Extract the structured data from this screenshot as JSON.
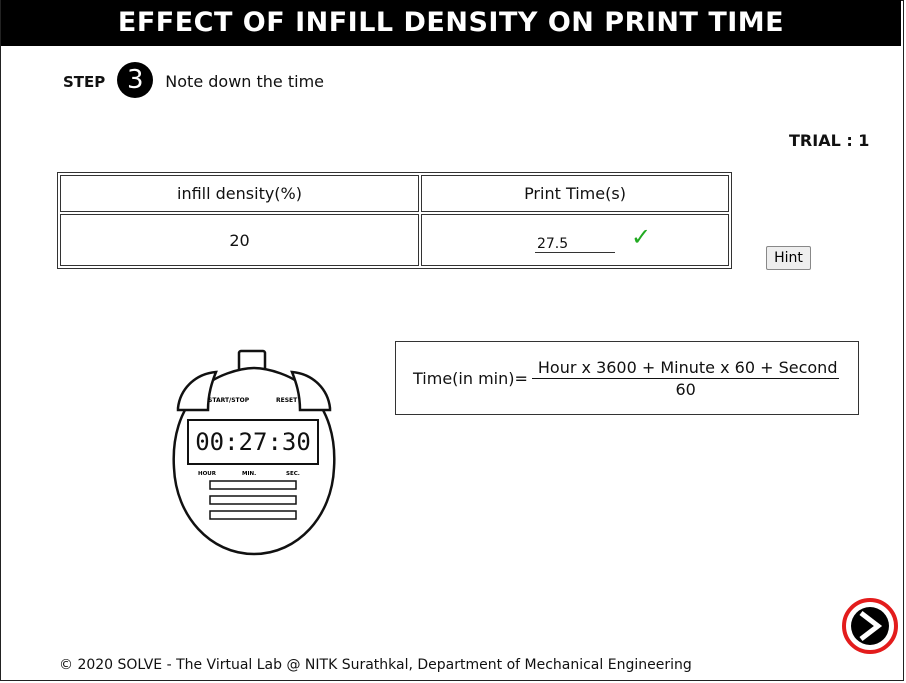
{
  "header": {
    "title": "EFFECT OF INFILL DENSITY ON PRINT TIME"
  },
  "step": {
    "label": "STEP",
    "number": "3",
    "instruction": "Note down the time"
  },
  "trial": {
    "label": "TRIAL : 1"
  },
  "table": {
    "headers": [
      "infill density(%)",
      "Print Time(s)"
    ],
    "row": {
      "density": "20",
      "print_time": "27.5"
    }
  },
  "hint": {
    "label": "Hint"
  },
  "formula": {
    "lhs": "Time(in min)=",
    "numerator": "Hour x 3600 + Minute x 60 + Second",
    "denominator": "60"
  },
  "stopwatch": {
    "display": "00:27:30",
    "start_stop_label": "START/STOP",
    "reset_label": "RESET",
    "hour_label": "HOUR",
    "min_label": "MIN.",
    "sec_label": "SEC."
  },
  "footer": {
    "text": "© 2020 SOLVE - The Virtual Lab @ NITK Surathkal, Department of Mechanical Engineering"
  },
  "colors": {
    "check": "#22aa22",
    "next_ring": "#e31c1c"
  },
  "icons": {
    "check": "check-icon",
    "next": "arrow-right-icon"
  }
}
